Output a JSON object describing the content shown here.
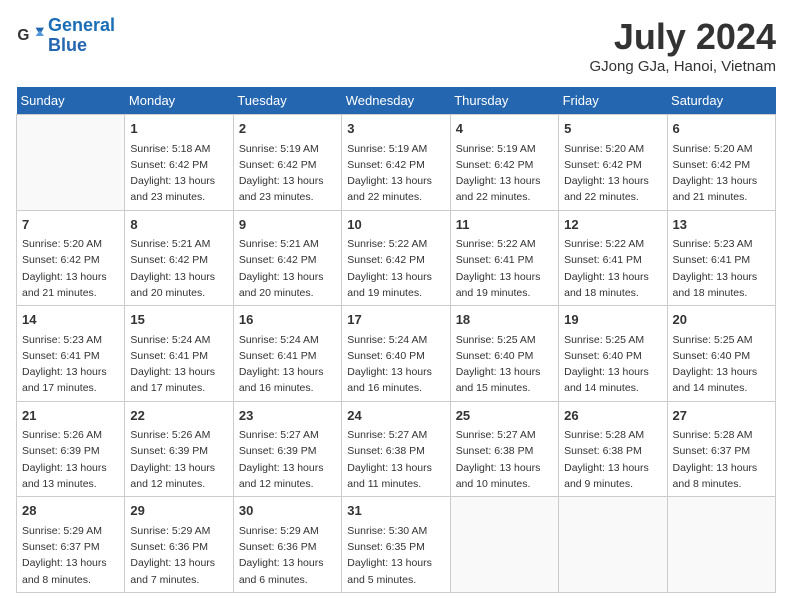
{
  "header": {
    "logo_text_general": "General",
    "logo_text_blue": "Blue",
    "month_year": "July 2024",
    "location": "GJong GJa, Hanoi, Vietnam"
  },
  "days_of_week": [
    "Sunday",
    "Monday",
    "Tuesday",
    "Wednesday",
    "Thursday",
    "Friday",
    "Saturday"
  ],
  "weeks": [
    [
      {
        "day": "",
        "info": ""
      },
      {
        "day": "1",
        "info": "Sunrise: 5:18 AM\nSunset: 6:42 PM\nDaylight: 13 hours\nand 23 minutes."
      },
      {
        "day": "2",
        "info": "Sunrise: 5:19 AM\nSunset: 6:42 PM\nDaylight: 13 hours\nand 23 minutes."
      },
      {
        "day": "3",
        "info": "Sunrise: 5:19 AM\nSunset: 6:42 PM\nDaylight: 13 hours\nand 22 minutes."
      },
      {
        "day": "4",
        "info": "Sunrise: 5:19 AM\nSunset: 6:42 PM\nDaylight: 13 hours\nand 22 minutes."
      },
      {
        "day": "5",
        "info": "Sunrise: 5:20 AM\nSunset: 6:42 PM\nDaylight: 13 hours\nand 22 minutes."
      },
      {
        "day": "6",
        "info": "Sunrise: 5:20 AM\nSunset: 6:42 PM\nDaylight: 13 hours\nand 21 minutes."
      }
    ],
    [
      {
        "day": "7",
        "info": "Sunrise: 5:20 AM\nSunset: 6:42 PM\nDaylight: 13 hours\nand 21 minutes."
      },
      {
        "day": "8",
        "info": "Sunrise: 5:21 AM\nSunset: 6:42 PM\nDaylight: 13 hours\nand 20 minutes."
      },
      {
        "day": "9",
        "info": "Sunrise: 5:21 AM\nSunset: 6:42 PM\nDaylight: 13 hours\nand 20 minutes."
      },
      {
        "day": "10",
        "info": "Sunrise: 5:22 AM\nSunset: 6:42 PM\nDaylight: 13 hours\nand 19 minutes."
      },
      {
        "day": "11",
        "info": "Sunrise: 5:22 AM\nSunset: 6:41 PM\nDaylight: 13 hours\nand 19 minutes."
      },
      {
        "day": "12",
        "info": "Sunrise: 5:22 AM\nSunset: 6:41 PM\nDaylight: 13 hours\nand 18 minutes."
      },
      {
        "day": "13",
        "info": "Sunrise: 5:23 AM\nSunset: 6:41 PM\nDaylight: 13 hours\nand 18 minutes."
      }
    ],
    [
      {
        "day": "14",
        "info": "Sunrise: 5:23 AM\nSunset: 6:41 PM\nDaylight: 13 hours\nand 17 minutes."
      },
      {
        "day": "15",
        "info": "Sunrise: 5:24 AM\nSunset: 6:41 PM\nDaylight: 13 hours\nand 17 minutes."
      },
      {
        "day": "16",
        "info": "Sunrise: 5:24 AM\nSunset: 6:41 PM\nDaylight: 13 hours\nand 16 minutes."
      },
      {
        "day": "17",
        "info": "Sunrise: 5:24 AM\nSunset: 6:40 PM\nDaylight: 13 hours\nand 16 minutes."
      },
      {
        "day": "18",
        "info": "Sunrise: 5:25 AM\nSunset: 6:40 PM\nDaylight: 13 hours\nand 15 minutes."
      },
      {
        "day": "19",
        "info": "Sunrise: 5:25 AM\nSunset: 6:40 PM\nDaylight: 13 hours\nand 14 minutes."
      },
      {
        "day": "20",
        "info": "Sunrise: 5:25 AM\nSunset: 6:40 PM\nDaylight: 13 hours\nand 14 minutes."
      }
    ],
    [
      {
        "day": "21",
        "info": "Sunrise: 5:26 AM\nSunset: 6:39 PM\nDaylight: 13 hours\nand 13 minutes."
      },
      {
        "day": "22",
        "info": "Sunrise: 5:26 AM\nSunset: 6:39 PM\nDaylight: 13 hours\nand 12 minutes."
      },
      {
        "day": "23",
        "info": "Sunrise: 5:27 AM\nSunset: 6:39 PM\nDaylight: 13 hours\nand 12 minutes."
      },
      {
        "day": "24",
        "info": "Sunrise: 5:27 AM\nSunset: 6:38 PM\nDaylight: 13 hours\nand 11 minutes."
      },
      {
        "day": "25",
        "info": "Sunrise: 5:27 AM\nSunset: 6:38 PM\nDaylight: 13 hours\nand 10 minutes."
      },
      {
        "day": "26",
        "info": "Sunrise: 5:28 AM\nSunset: 6:38 PM\nDaylight: 13 hours\nand 9 minutes."
      },
      {
        "day": "27",
        "info": "Sunrise: 5:28 AM\nSunset: 6:37 PM\nDaylight: 13 hours\nand 8 minutes."
      }
    ],
    [
      {
        "day": "28",
        "info": "Sunrise: 5:29 AM\nSunset: 6:37 PM\nDaylight: 13 hours\nand 8 minutes."
      },
      {
        "day": "29",
        "info": "Sunrise: 5:29 AM\nSunset: 6:36 PM\nDaylight: 13 hours\nand 7 minutes."
      },
      {
        "day": "30",
        "info": "Sunrise: 5:29 AM\nSunset: 6:36 PM\nDaylight: 13 hours\nand 6 minutes."
      },
      {
        "day": "31",
        "info": "Sunrise: 5:30 AM\nSunset: 6:35 PM\nDaylight: 13 hours\nand 5 minutes."
      },
      {
        "day": "",
        "info": ""
      },
      {
        "day": "",
        "info": ""
      },
      {
        "day": "",
        "info": ""
      }
    ]
  ]
}
